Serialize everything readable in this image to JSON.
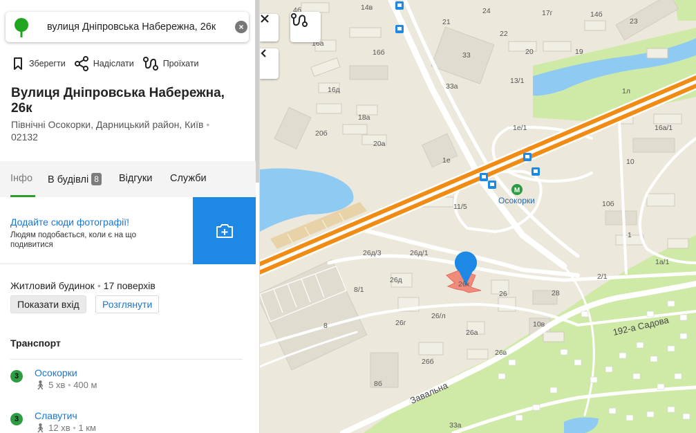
{
  "search": {
    "value": "вулиця Дніпровська Набережна, 26к"
  },
  "actions": [
    {
      "label": "Зберегти",
      "icon": "bookmark-icon"
    },
    {
      "label": "Надіслати",
      "icon": "share-icon"
    },
    {
      "label": "Проїхати",
      "icon": "route-icon"
    }
  ],
  "place": {
    "title": "Вулиця Дніпровська Набережна, 26к",
    "address_line1": "Північні Осокорки, Дарницький район, Київ",
    "address_dot": "•",
    "address_line2": "02132"
  },
  "tabs": {
    "info": "Інфо",
    "in_building": "В будівлі",
    "in_building_count": "8",
    "reviews": "Відгуки",
    "services": "Служби"
  },
  "photo": {
    "link": "Додайте сюди фотографії!",
    "description": "Людям подобається, коли є на що подивитися"
  },
  "building": {
    "type": "Житловий будинок",
    "sep": "•",
    "floors": "17 поверхів",
    "show_entrance": "Показати вхід",
    "view": "Розглянути"
  },
  "transport": {
    "title": "Транспорт",
    "stations": [
      {
        "line": "3",
        "name": "Осокорки",
        "walk": "5 хв",
        "sep": "•",
        "distance": "400 м"
      },
      {
        "line": "3",
        "name": "Славутич",
        "walk": "12 хв",
        "sep": "•",
        "distance": "1 км"
      }
    ]
  },
  "map": {
    "labels": {
      "b4b": "4б",
      "b14v": "14в",
      "b24": "24",
      "b17g": "17г",
      "b14b": "14б",
      "b23": "23",
      "b21": "21",
      "b22": "22",
      "b16a": "16а",
      "b16b": "16б",
      "b33": "33",
      "b20": "20",
      "b19": "19",
      "b16d": "16д",
      "b33a": "33а",
      "b13_1": "13/1",
      "b1l": "1л",
      "b18a": "18а",
      "b20b": "20б",
      "b1e_1": "1е/1",
      "b16a_1": "16а/1",
      "b20a": "20а",
      "b1e": "1е",
      "b10": "10",
      "b11_5": "11/5",
      "b10b": "10б",
      "b1": "1",
      "b26d3": "26д/3",
      "b26d1": "26д/1",
      "b26d": "26д",
      "b8_1": "8/1",
      "b26k": "26к",
      "b26": "26",
      "b28": "28",
      "b1a_1": "1а/1",
      "b2_1": "2/1",
      "b26g": "26г",
      "b26l": "26/л",
      "b8": "8",
      "b26a": "26а",
      "b10v": "10в",
      "b26b": "26б",
      "b26v": "26в",
      "b8b": "8б",
      "b33a2": "33а"
    },
    "metro_name": "Осокорки",
    "street_sadova": "192-а Садова",
    "street_zavalna": "Завальна"
  }
}
